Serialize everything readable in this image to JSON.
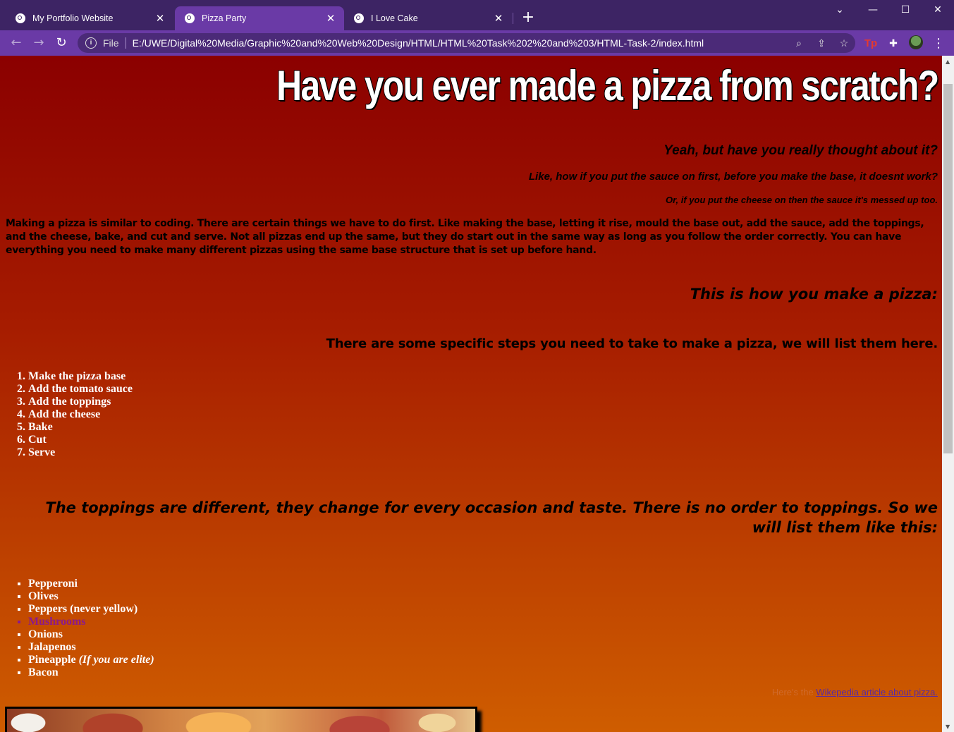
{
  "browser": {
    "tabs": [
      {
        "title": "My Portfolio Website",
        "active": false
      },
      {
        "title": "Pizza Party",
        "active": true
      },
      {
        "title": "I Love Cake",
        "active": false
      }
    ],
    "new_tab_symbol": "+",
    "address": {
      "scheme_label": "File",
      "url": "E:/UWE/Digital%20Media/Graphic%20and%20Web%20Design/HTML/HTML%20Task%202%20and%203/HTML-Task-2/index.html"
    },
    "icons": [
      "back-icon",
      "forward-icon",
      "reload-icon",
      "info-icon",
      "zoom-icon",
      "share-icon",
      "star-icon",
      "tp-extension-icon",
      "puzzle-icon",
      "avatar",
      "kebab-menu-icon"
    ],
    "colors": {
      "tabbar": "#3d2464",
      "toolbar": "#6a3aa6",
      "omnibox": "#4b2a78"
    }
  },
  "page": {
    "heading": "Have you ever made a pizza from scratch?",
    "sub1": "Yeah, but have you really thought about it?",
    "sub2": "Like, how if you put the sauce on first, before you make the base, it doesnt work?",
    "sub3": "Or, if you put the cheese on then the sauce it's messed up too.",
    "intro": "Making a pizza is similar to coding. There are certain things we have to do first. Like making the base, letting it rise, mould the base out, add the sauce, add the toppings, and the cheese, bake, and cut and serve. Not all pizzas end up the same, but they do start out in the same way as long as you follow the order correctly. You can have everything you need to make many different pizzas using the same base structure that is set up before hand.",
    "how_heading": "This is how you make a pizza:",
    "steps_heading": "There are some specific steps you need to take to make a pizza, we will list them here.",
    "steps": [
      "Make the pizza base",
      "Add the tomato sauce",
      "Add the toppings",
      "Add the cheese",
      "Bake",
      "Cut",
      "Serve"
    ],
    "toppings_heading": "The toppings are different, they change for every occasion and taste. There is no order to toppings. So we will list them like this:",
    "toppings": [
      "Pepperoni",
      "Olives",
      "Peppers (never yellow)",
      "Mushrooms",
      "Onions",
      "Jalapenos",
      "Pineapple",
      "Bacon"
    ],
    "pineapple_note": "(If you are elite)",
    "wiki_prefix": "Here's the ",
    "wiki_link": "Wikepedia article about pizza.",
    "colors": {
      "gradient_top": "#8b0000",
      "gradient_bottom": "#cf5d00",
      "heading_text": "#ffffff",
      "mushrooms": "#8b1a8b"
    }
  }
}
